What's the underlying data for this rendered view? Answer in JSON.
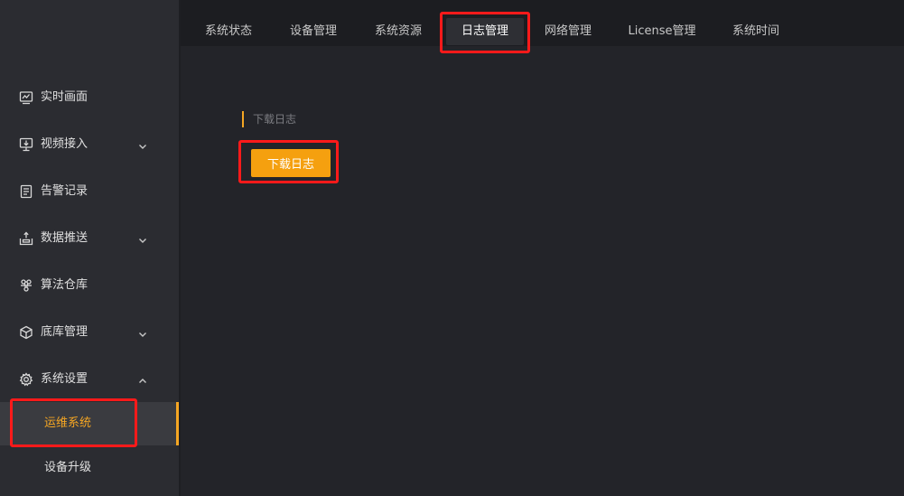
{
  "sidebar": {
    "items": [
      {
        "label": "实时画面",
        "icon": "monitor-chart-icon",
        "has_children": false
      },
      {
        "label": "视频接入",
        "icon": "video-input-icon",
        "has_children": true
      },
      {
        "label": "告警记录",
        "icon": "document-list-icon",
        "has_children": false
      },
      {
        "label": "数据推送",
        "icon": "upload-tray-icon",
        "has_children": true
      },
      {
        "label": "算法仓库",
        "icon": "algorithm-network-icon",
        "has_children": false
      },
      {
        "label": "底库管理",
        "icon": "cube-icon",
        "has_children": true
      },
      {
        "label": "系统设置",
        "icon": "gear-icon",
        "has_children": true,
        "expanded": true
      }
    ],
    "subitems": [
      {
        "label": "运维系统",
        "active": true
      },
      {
        "label": "设备升级",
        "active": false
      }
    ]
  },
  "tabs": [
    {
      "label": "系统状态"
    },
    {
      "label": "设备管理"
    },
    {
      "label": "系统资源"
    },
    {
      "label": "日志管理",
      "active": true
    },
    {
      "label": "网络管理"
    },
    {
      "label": "License管理"
    },
    {
      "label": "系统时间"
    }
  ],
  "main": {
    "section_title": "下载日志",
    "download_button": "下载日志"
  },
  "colors": {
    "accent": "#f5a623",
    "highlight": "#ff1a1a",
    "background": "#232429",
    "sidebar": "#2b2c31"
  }
}
